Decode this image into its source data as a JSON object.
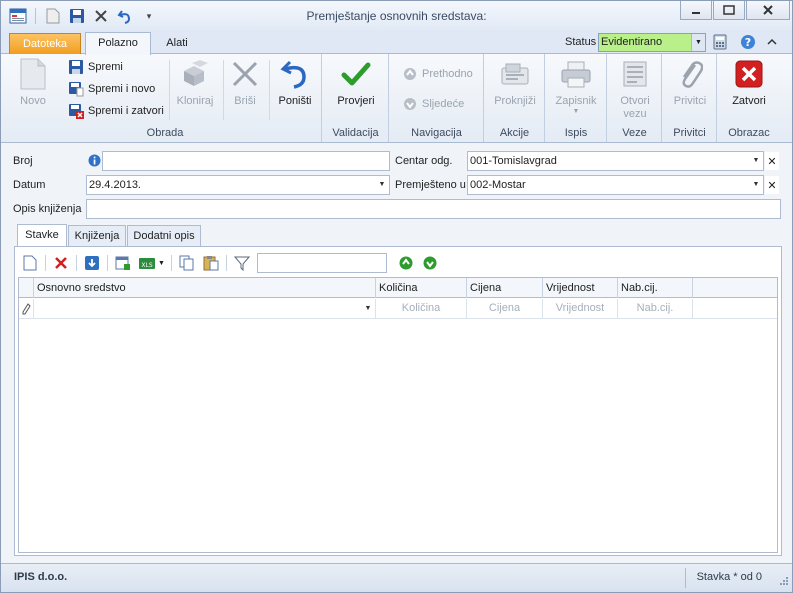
{
  "window": {
    "title": "Premještanje osnovnih sredstava:"
  },
  "menu": {
    "file": "Datoteka",
    "home": "Polazno",
    "tools": "Alati",
    "status_label": "Status",
    "status_value": "Evidentirano"
  },
  "ribbon": {
    "obrada": {
      "label": "Obrada",
      "novo": "Novo",
      "spremi": "Spremi",
      "spremi_novo": "Spremi i novo",
      "spremi_zatvori": "Spremi i zatvori",
      "kloniraj": "Kloniraj",
      "brisi": "Briši",
      "ponisti": "Poništi"
    },
    "validacija": {
      "label": "Validacija",
      "provjeri": "Provjeri"
    },
    "navigacija": {
      "label": "Navigacija",
      "prethodno": "Prethodno",
      "sljedece": "Sljedeće"
    },
    "akcije": {
      "label": "Akcije",
      "proknjizi": "Proknjiži"
    },
    "ispis": {
      "label": "Ispis",
      "zapisnik": "Zapisnik"
    },
    "veze": {
      "label": "Veze",
      "otvori1": "Otvori",
      "otvori2": "vezu"
    },
    "privitci": {
      "label": "Privitci",
      "privitci": "Privitci"
    },
    "obrazac": {
      "label": "Obrazac",
      "zatvori": "Zatvori"
    }
  },
  "form": {
    "broj_label": "Broj",
    "broj_value": "",
    "datum_label": "Datum",
    "datum_value": "29.4.2013.",
    "centar_label": "Centar odg.",
    "centar_value": "001-Tomislavgrad",
    "premjesteno_label": "Premješteno u",
    "premjesteno_value": "002-Mostar",
    "opis_label": "Opis knjiženja",
    "opis_value": ""
  },
  "tabs": [
    "Stavke",
    "Knjiženja",
    "Dodatni opis"
  ],
  "grid": {
    "search_value": "",
    "columns": [
      "Osnovno sredstvo",
      "Količina",
      "Cijena",
      "Vrijednost",
      "Nab.cij."
    ],
    "new_row_placeholders": [
      "",
      "Količina",
      "Cijena",
      "Vrijednost",
      "Nab.cij."
    ]
  },
  "statusbar": {
    "company": "IPIS d.o.o.",
    "position": "Stavka * od 0"
  },
  "colors": {
    "status_bg": "#b9f08a",
    "file_tab": "#f19e1f",
    "delete_red": "#d22020",
    "validate_green": "#2c9c2c"
  }
}
